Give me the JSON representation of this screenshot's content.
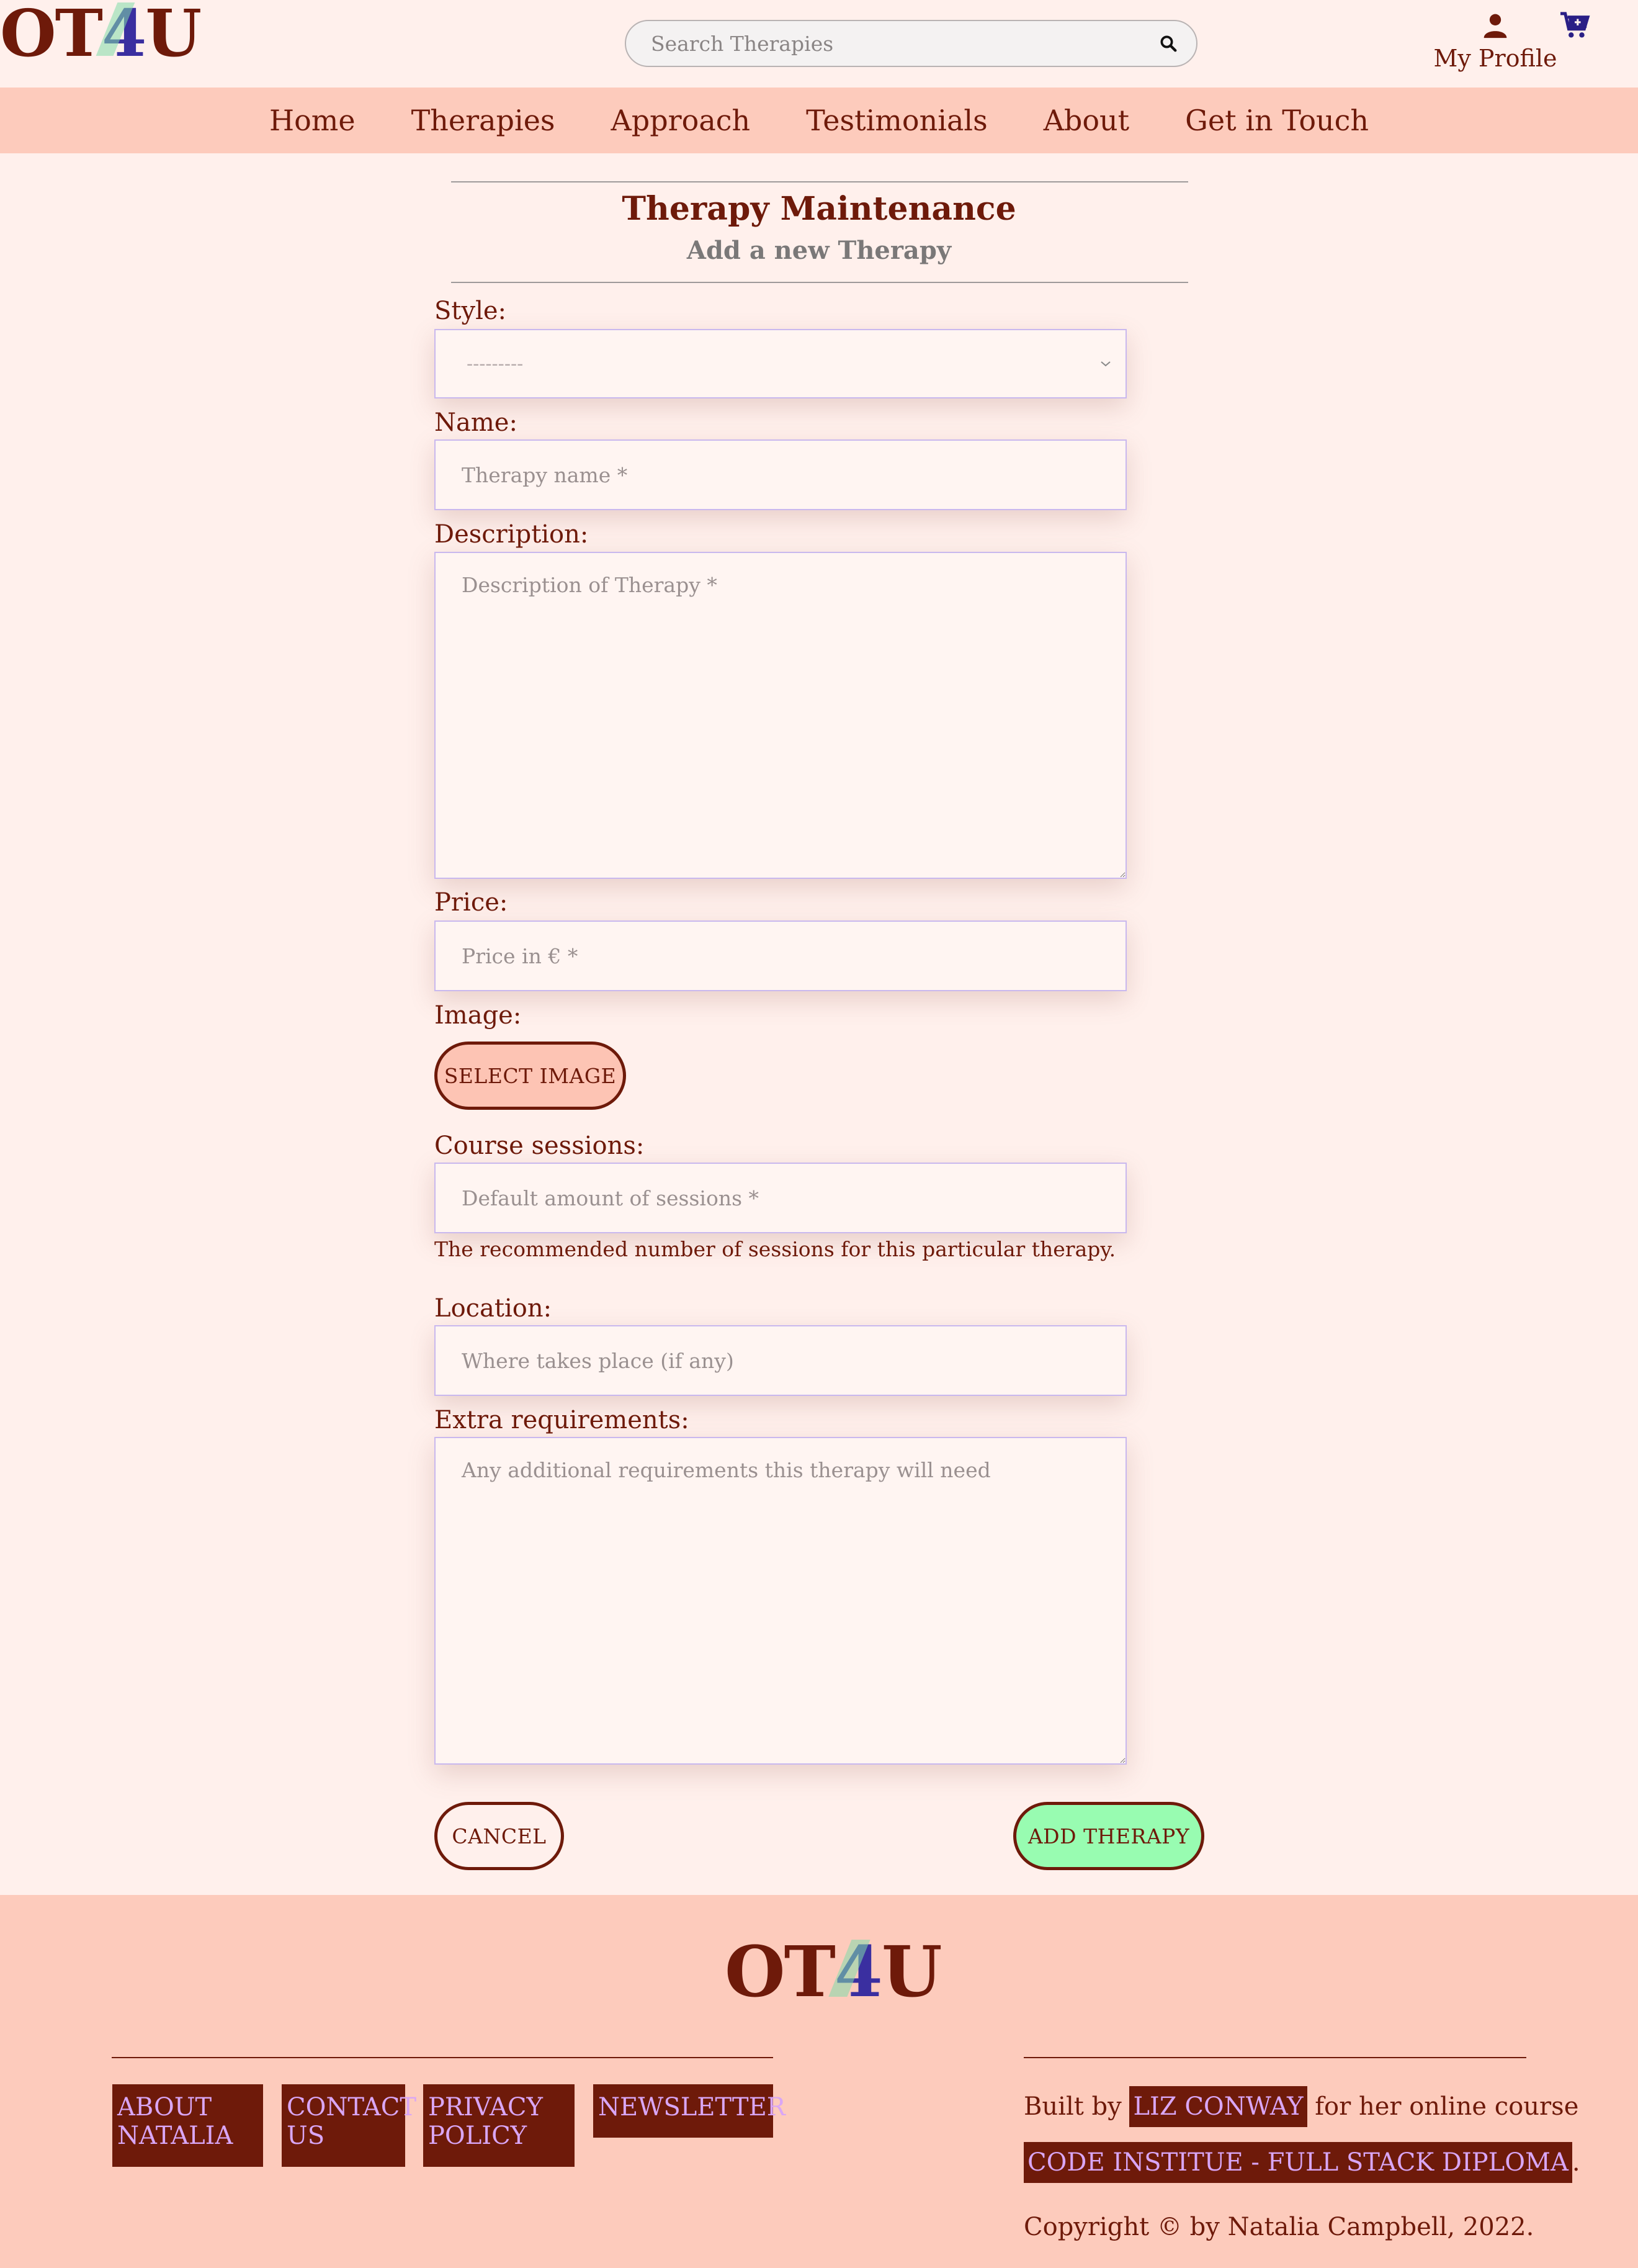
{
  "brand": {
    "logo_left": "OT",
    "logo_four": "4",
    "logo_right": "U",
    "colors": {
      "primary": "#6e1a0a",
      "background": "#fff0ec",
      "nav": "#fdcbbc",
      "accent_green": "#98fcb1",
      "link_lilac": "#d9a6f5"
    }
  },
  "header": {
    "search_placeholder": "Search Therapies",
    "search_icon": "search-icon",
    "profile_label": "My Profile",
    "profile_icon": "user-icon",
    "cart_icon": "cart-icon"
  },
  "nav": {
    "items": [
      "Home",
      "Therapies",
      "Approach",
      "Testimonials",
      "About",
      "Get in Touch"
    ]
  },
  "page": {
    "title": "Therapy Maintenance",
    "subtitle": "Add a new Therapy"
  },
  "form": {
    "style_label": "Style:",
    "style_selected": "---------",
    "name_label": "Name:",
    "name_placeholder": "Therapy name *",
    "description_label": "Description:",
    "description_placeholder": "Description of Therapy *",
    "price_label": "Price:",
    "price_placeholder": "Price in € *",
    "image_label": "Image:",
    "select_image_button": "SELECT IMAGE",
    "sessions_label": "Course sessions:",
    "sessions_placeholder": "Default amount of sessions *",
    "sessions_help": "The recommended number of sessions for this particular therapy.",
    "location_label": "Location:",
    "location_placeholder": "Where takes place (if any)",
    "extra_label": "Extra requirements:",
    "extra_placeholder": "Any additional requirements this therapy will need",
    "cancel_button": "CANCEL",
    "add_button": "ADD THERAPY"
  },
  "footer": {
    "links": [
      {
        "line1": "ABOUT",
        "line2": "NATALIA"
      },
      {
        "line1": "CONTACT",
        "line2": "US"
      },
      {
        "line1": "PRIVACY",
        "line2": "POLICY"
      },
      {
        "line1": "NEWSLETTER",
        "line2": ""
      }
    ],
    "built_by": "Built by",
    "author": "LIZ CONWAY",
    "course_text": "for her online course",
    "course": "CODE INSTITUE - FULL STACK DIPLOMA",
    "period": ".",
    "copyright": "Copyright © by Natalia Campbell, 2022."
  }
}
